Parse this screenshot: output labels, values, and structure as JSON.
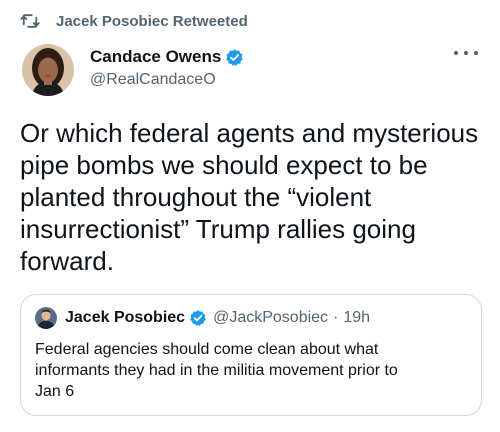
{
  "retweet": {
    "icon": "retweet-icon",
    "label": "Jacek Posobiec Retweeted"
  },
  "author": {
    "name": "Candace Owens",
    "handle": "@RealCandaceO",
    "verified": true,
    "avatar": "avatar"
  },
  "more_menu": {
    "icon": "more-horizontal-icon"
  },
  "tweet": {
    "text": "Or which federal agents and mysterious\npipe bombs we should expect to be\nplanted throughout the “violent\ninsurrectionist” Trump rallies going\nforward."
  },
  "quote": {
    "name": "Jacek Posobiec",
    "handle": "@JackPosobiec",
    "separator": "·",
    "time": "19h",
    "verified": true,
    "text": "Federal agencies should come clean about what\ninformants they had in the militia movement prior to\nJan 6"
  },
  "colors": {
    "text_primary": "#0f1419",
    "text_secondary": "#536471",
    "verified_blue": "#1d9bf0",
    "border": "#cfd9de"
  }
}
